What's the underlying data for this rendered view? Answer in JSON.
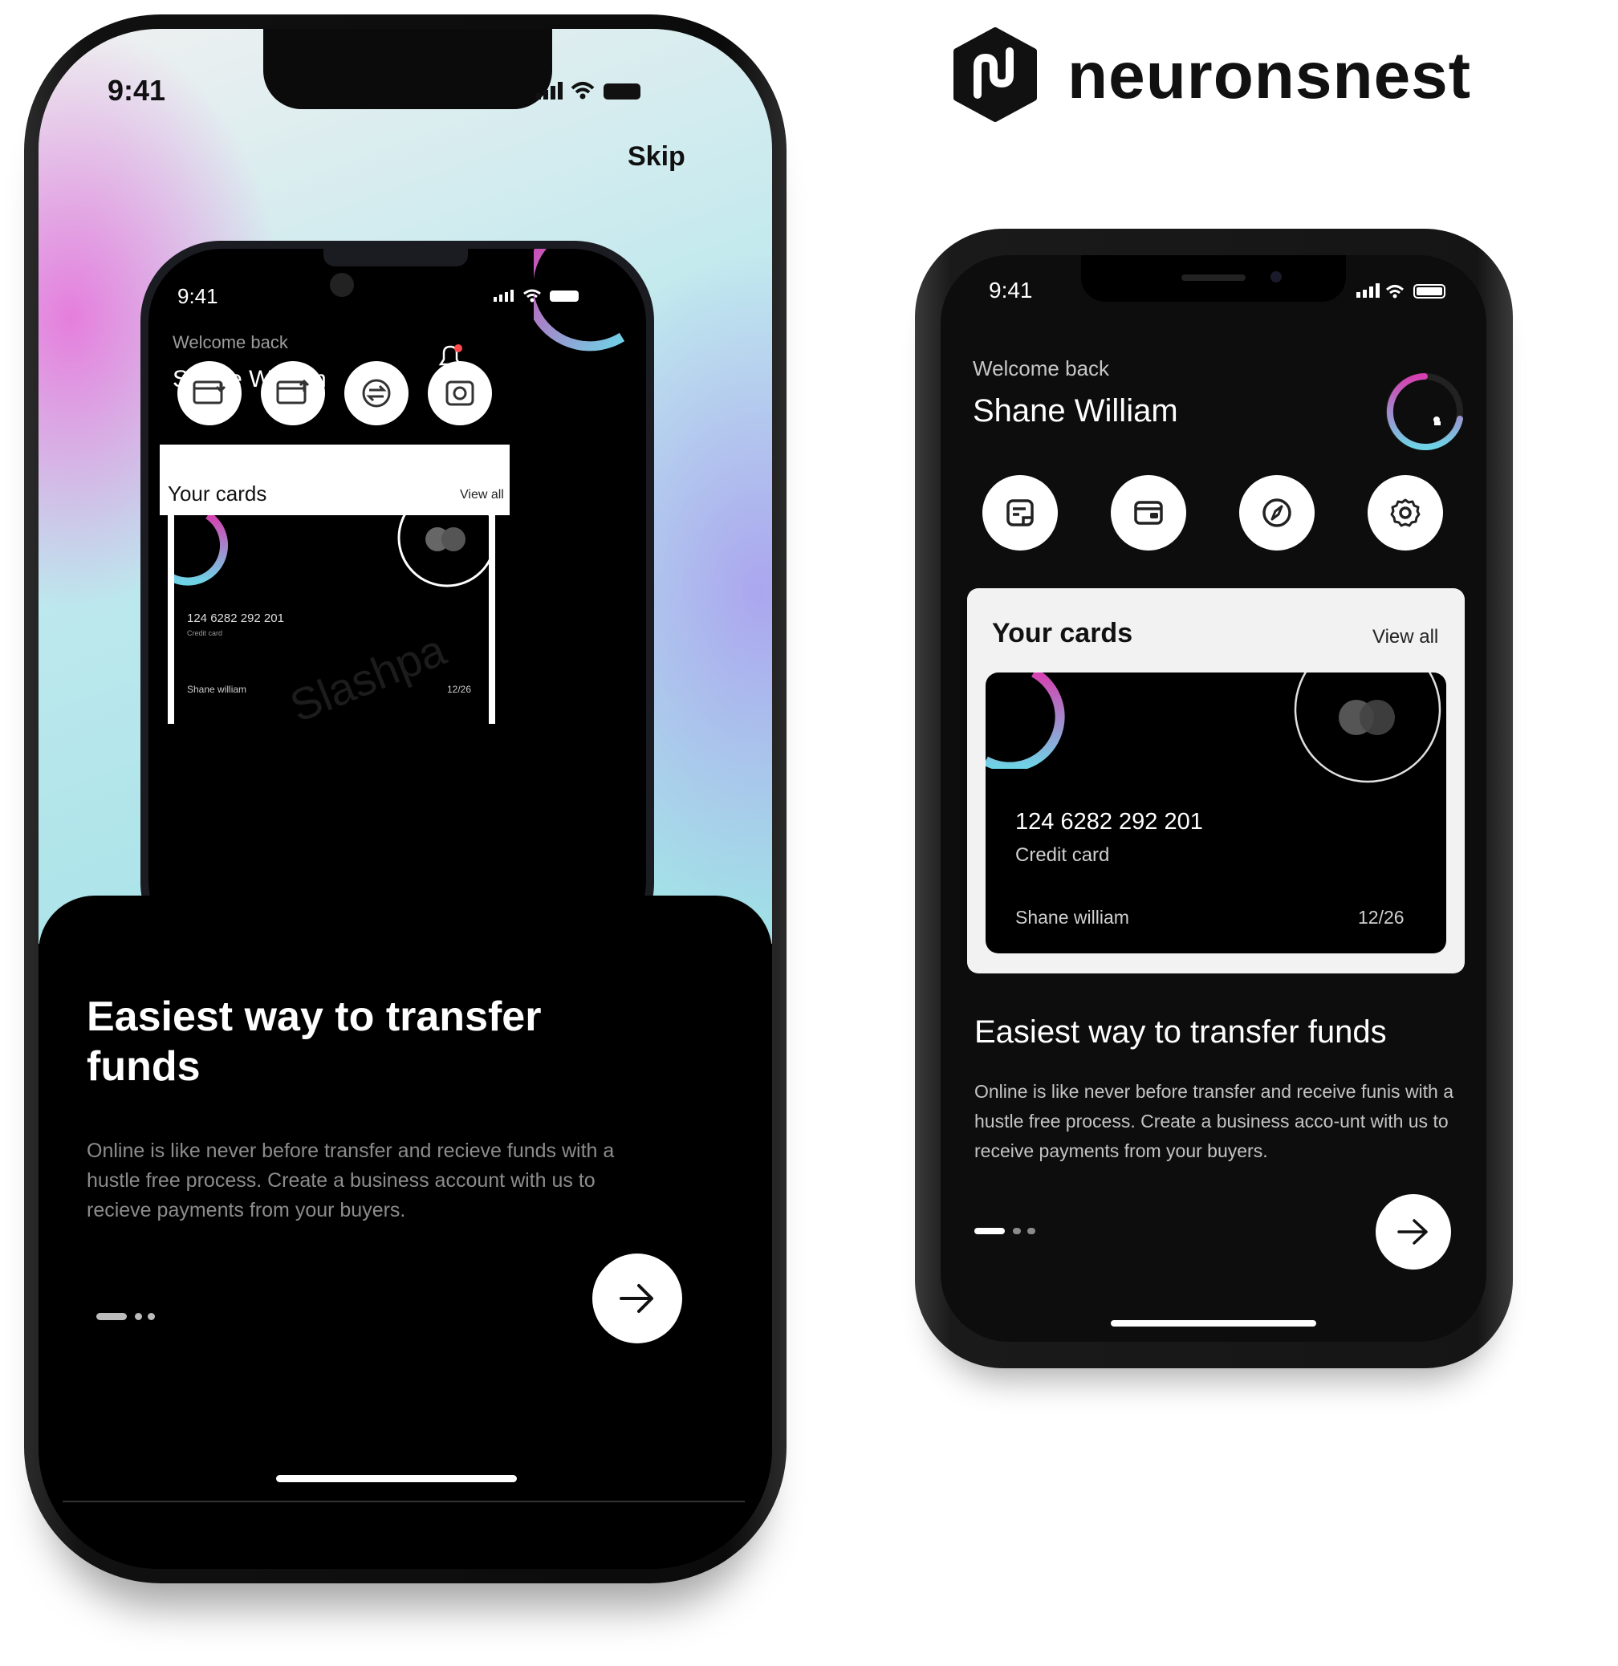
{
  "brand": {
    "name": "neuronsnest"
  },
  "left_phone": {
    "status": {
      "time": "9:41"
    },
    "skip_label": "Skip",
    "inner_app": {
      "time": "9:41",
      "welcome": "Welcome back",
      "user_name": "Shane William",
      "cards_title": "Your cards",
      "view_all": "View all",
      "card": {
        "number": "124 6282 292 201",
        "type": "Credit card",
        "holder": "Shane william",
        "expiry": "12/26",
        "watermark": "Slashpa"
      }
    },
    "title": "Easiest way to transfer funds",
    "body": "Online is like never before transfer and recieve funds with a hustle free process. Create a business account with us to recieve payments from your buyers."
  },
  "right_phone": {
    "status": {
      "time": "9:41"
    },
    "welcome": "Welcome back",
    "user_name": "Shane William",
    "quick_actions": [
      "note-icon",
      "wallet-icon",
      "compass-icon",
      "settings-icon"
    ],
    "cards_title": "Your cards",
    "view_all": "View all",
    "card": {
      "number": "124 6282 292 201",
      "type": "Credit card",
      "holder": "Shane william",
      "expiry": "12/26"
    },
    "title": "Easiest way to transfer funds",
    "body": "Online is like never before transfer and receive funis with a hustle free process. Create a business acco-unt with us to receive payments from your buyers."
  },
  "colors": {
    "accent_pink": "#d63fb0",
    "accent_cyan": "#6fd3e6",
    "background_dark": "#0d0d0d"
  }
}
